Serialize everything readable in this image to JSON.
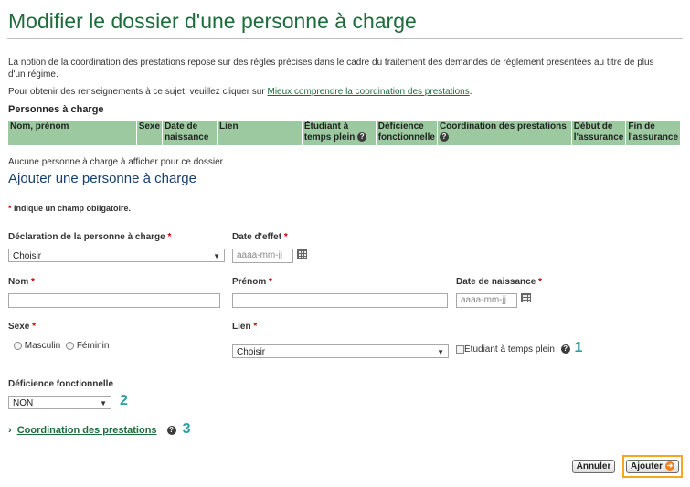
{
  "page": {
    "title": "Modifier le dossier d'une personne à charge",
    "intro_text": "La notion de la coordination des prestations repose sur des règles précises dans le cadre du traitement des demandes de règlement présentées au titre de plus d'un régime.",
    "info_prefix": "Pour obtenir des renseignements à ce sujet, veuillez cliquer sur ",
    "info_link": "Mieux comprendre la coordination des prestations",
    "info_suffix": "."
  },
  "dependents": {
    "heading": "Personnes à charge",
    "columns": [
      "Nom, prénom",
      "Sexe",
      "Date de naissance",
      "Lien",
      "Étudiant à temps plein",
      "Déficience fonctionnelle",
      "Coordination des prestations",
      "Début de l'assurance",
      "Fin de l'assurance"
    ],
    "empty_message": "Aucune personne à charge à afficher pour ce dossier."
  },
  "form": {
    "heading": "Ajouter une personne à charge",
    "required_star": "*",
    "required_note": "Indique un champ obligatoire.",
    "declaration": {
      "label": "Déclaration de la personne à charge",
      "value": "Choisir"
    },
    "effective_date": {
      "label": "Date d'effet",
      "placeholder": "aaaa-mm-jj"
    },
    "last_name": {
      "label": "Nom",
      "value": ""
    },
    "first_name": {
      "label": "Prénom",
      "value": ""
    },
    "birth_date": {
      "label": "Date de naissance",
      "placeholder": "aaaa-mm-jj"
    },
    "sex": {
      "label": "Sexe",
      "options": [
        "Masculin",
        "Féminin"
      ]
    },
    "relationship": {
      "label": "Lien",
      "value": "Choisir"
    },
    "student": {
      "label": "Étudiant à temps plein",
      "marker": "1"
    },
    "disability": {
      "label": "Déficience fonctionnelle",
      "value": "NON",
      "marker": "2"
    },
    "coordination": {
      "label": "Coordination des prestations",
      "marker": "3",
      "chevron": "›"
    }
  },
  "buttons": {
    "cancel": "Annuler",
    "add": "Ajouter"
  },
  "colors": {
    "title": "#1e6b3c",
    "table_header": "#9dc9a1",
    "heading_blue": "#173f6b",
    "marker": "#2a9fa0",
    "highlight": "#f5a623"
  }
}
